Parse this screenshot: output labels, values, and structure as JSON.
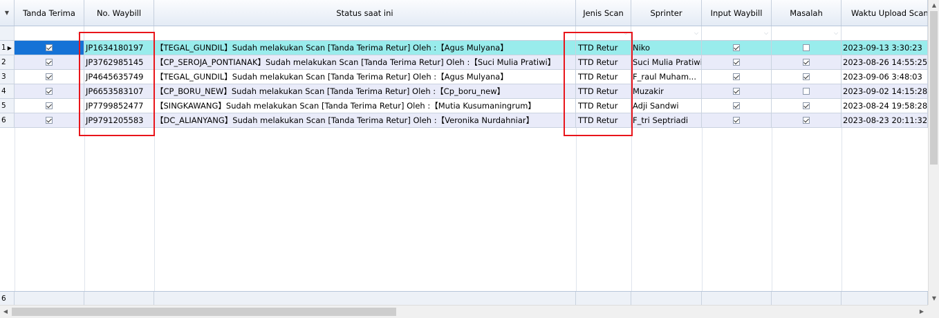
{
  "columns": {
    "tanda_terima": "Tanda Terima",
    "no_waybill": "No. Waybill",
    "status": "Status saat ini",
    "jenis_scan": "Jenis Scan",
    "sprinter": "Sprinter",
    "input_waybill": "Input Waybill",
    "masalah": "Masalah",
    "waktu_upload": "Waktu Upload Scan"
  },
  "rows": [
    {
      "num": "1",
      "tanda_terima": true,
      "waybill": "JP1634180197",
      "status": "【TEGAL_GUNDIL】Sudah melakukan Scan [Tanda Terima Retur] Oleh :【Agus Mulyana】",
      "jenis": "TTD Retur",
      "sprinter": "Niko",
      "input": true,
      "masalah": false,
      "waktu": "2023-09-13 3:30:23"
    },
    {
      "num": "2",
      "tanda_terima": true,
      "waybill": "JP3762985145",
      "status": "【CP_SEROJA_PONTIANAK】Sudah melakukan Scan [Tanda Terima Retur] Oleh :【Suci Mulia Pratiwi】",
      "jenis": "TTD Retur",
      "sprinter": "Suci Mulia Pratiwi",
      "input": true,
      "masalah": true,
      "waktu": "2023-08-26 14:55:25"
    },
    {
      "num": "3",
      "tanda_terima": true,
      "waybill": "JP4645635749",
      "status": "【TEGAL_GUNDIL】Sudah melakukan Scan [Tanda Terima Retur] Oleh :【Agus Mulyana】",
      "jenis": "TTD Retur",
      "sprinter": "F_raul Muham...",
      "input": true,
      "masalah": true,
      "waktu": "2023-09-06 3:48:03"
    },
    {
      "num": "4",
      "tanda_terima": true,
      "waybill": "JP6653583107",
      "status": "【CP_BORU_NEW】Sudah melakukan Scan [Tanda Terima Retur] Oleh :【Cp_boru_new】",
      "jenis": "TTD Retur",
      "sprinter": "Muzakir",
      "input": true,
      "masalah": false,
      "waktu": "2023-09-02 14:15:28"
    },
    {
      "num": "5",
      "tanda_terima": true,
      "waybill": "JP7799852477",
      "status": "【SINGKAWANG】Sudah melakukan Scan [Tanda Terima Retur] Oleh :【Mutia Kusumaningrum】",
      "jenis": "TTD Retur",
      "sprinter": "Adji Sandwi",
      "input": true,
      "masalah": true,
      "waktu": "2023-08-24 19:58:28"
    },
    {
      "num": "6",
      "tanda_terima": true,
      "waybill": "JP9791205583",
      "status": "【DC_ALIANYANG】Sudah melakukan Scan [Tanda Terima Retur] Oleh :【Veronika Nurdahniar】",
      "jenis": "TTD Retur",
      "sprinter": "F_tri Septriadi",
      "input": true,
      "masalah": true,
      "waktu": "2023-08-23 20:11:32"
    }
  ],
  "footer": {
    "count": "6"
  },
  "colors": {
    "selected_row": "#99ecec",
    "alt_row": "#e9ebf9",
    "focus_cell": "#1572d6",
    "highlight_box": "#e8141a"
  },
  "icons": {
    "sort": "triangle-down-icon",
    "row_pointer": "triangle-right-icon",
    "filter": "chevron-down-icon"
  }
}
